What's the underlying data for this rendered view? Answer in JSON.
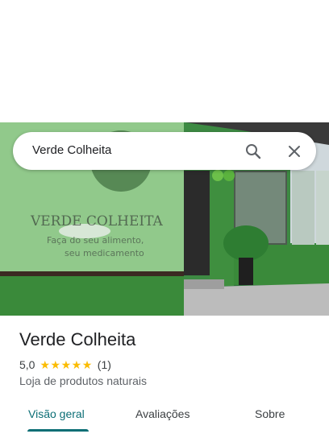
{
  "search": {
    "query": "Verde Colheita"
  },
  "photo": {
    "sign_name": "VERDE COLHEITA",
    "sign_tagline_1": "Faça do seu alimento,",
    "sign_tagline_2": "seu medicamento"
  },
  "place": {
    "title": "Verde Colheita",
    "rating": "5,0",
    "stars": 5,
    "review_count": "(1)",
    "category": "Loja de produtos naturais"
  },
  "tabs": [
    {
      "label": "Visão geral",
      "active": true
    },
    {
      "label": "Avaliações",
      "active": false
    },
    {
      "label": "Sobre",
      "active": false
    }
  ],
  "colors": {
    "accent": "#0b6e75",
    "star": "#fbbc04",
    "storefront_green": "#3f8f3f"
  },
  "icons": [
    "search-icon",
    "close-icon",
    "star-icon"
  ]
}
